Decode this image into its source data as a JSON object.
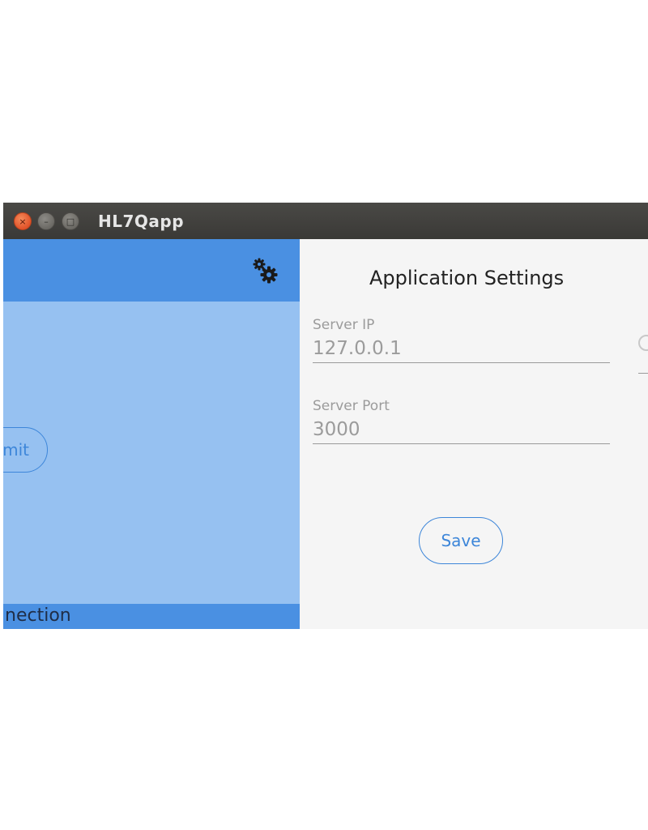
{
  "window": {
    "title": "HL7Qapp",
    "controls": {
      "close": "×",
      "minimize": "–",
      "maximize": "□"
    }
  },
  "left_panel": {
    "settings_icon": "gears-icon",
    "submit_label": "mit",
    "status_text": "nection"
  },
  "settings": {
    "title": "Application Settings",
    "server_ip": {
      "label": "Server IP",
      "value": "127.0.0.1"
    },
    "server_port": {
      "label": "Server Port",
      "value": "3000"
    },
    "save_label": "Save"
  },
  "colors": {
    "header_blue": "#4a90e2",
    "panel_light_blue": "#96c1f1",
    "accent": "#3d86d9"
  }
}
